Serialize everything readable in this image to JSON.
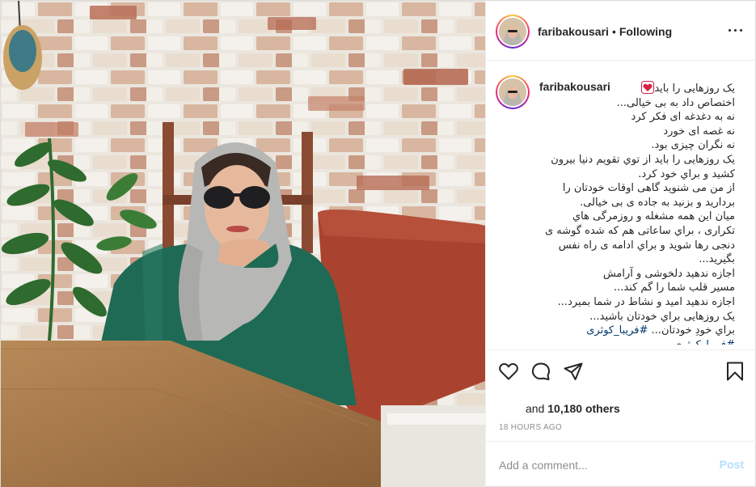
{
  "post": {
    "author": {
      "username": "faribakousari",
      "follow_status": "Following",
      "separator": "•"
    },
    "caption_lines": [
      "یک روزهایی را باید",
      "اختصاص داد به بی خیالی...",
      "نه به دغدغه ای فکر کرد",
      "نه غصه ای خورد",
      "نه نگران چیزی بود.",
      "یک روزهایی را باید از توي تقویم دنیا بیرون",
      "کشید و براي خود کرد.",
      "از من می شنوید گاهی اوقات خودتان را",
      "بردارید و بزنید به جاده ی بی خیالی.",
      "میان این همه مشغله و روزمرگی هاي",
      "تکراری ، براي ساعاتی هم که شده گوشه ی",
      "دنجی رها شوید و براي ادامه ی راه نفس",
      "بگیرید...",
      "اجازه ندهید دلخوشی و آرامش",
      "مسیر قلب شما را گم کند...",
      "اجازه ندهید امید و نشاط در شما بمیرد...",
      "یک روزهایی براي خودتان باشید...",
      "براي خودِ خودتان..."
    ],
    "hashtag": "#فریبا_کوثری",
    "hashtag_cut": "#فریبا_کوثری",
    "likes_prefix": "and ",
    "likes_count": "10,180 others",
    "timestamp": "18 HOURS AGO",
    "comment": {
      "placeholder": "Add a comment...",
      "post_label": "Post"
    }
  },
  "icons": {
    "more": "more-options-icon",
    "like": "heart-outline-icon",
    "comment": "comment-bubble-icon",
    "share": "paper-plane-icon",
    "save": "bookmark-icon",
    "emoji": "red-heart-emoji"
  },
  "colors": {
    "text": "#262626",
    "muted": "#8e8e8e",
    "border": "#dbdbdb",
    "link": "#00376b",
    "post_disabled": "#b2dffc"
  }
}
